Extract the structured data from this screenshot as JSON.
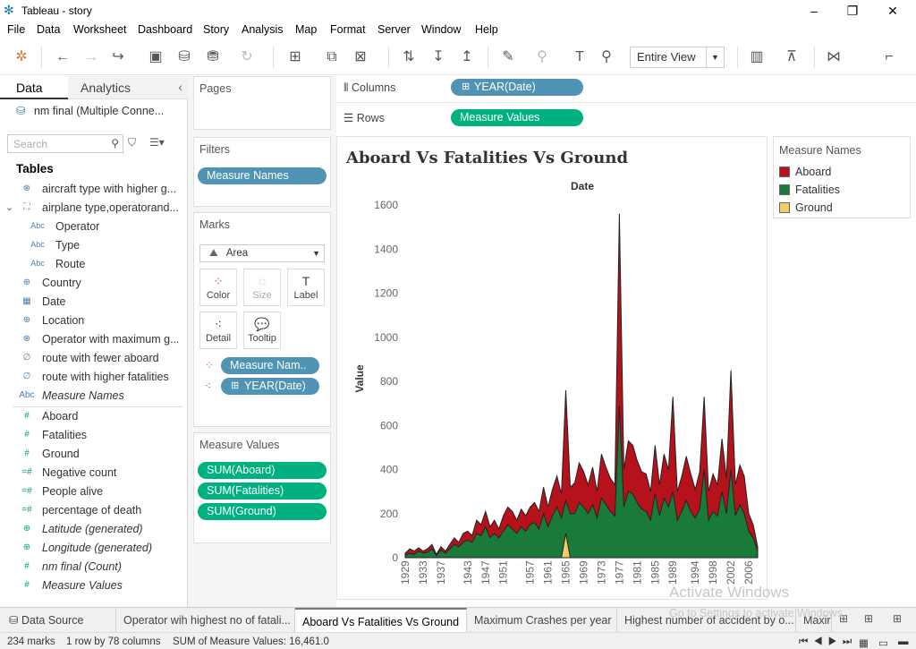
{
  "window": {
    "title": "Tableau - story",
    "min": "–",
    "max": "❐",
    "close": "✕"
  },
  "menu": [
    "File",
    "Data",
    "Worksheet",
    "Dashboard",
    "Story",
    "Analysis",
    "Map",
    "Format",
    "Server",
    "Window",
    "Help"
  ],
  "toolbar": {
    "fit_label": "Entire View"
  },
  "left": {
    "tab_data": "Data",
    "tab_analytics": "Analytics",
    "datasource": "nm final (Multiple Conne...",
    "search_placeholder": "Search",
    "tables_heading": "Tables",
    "fields": [
      {
        "label": "aircraft type with higher g...",
        "icon": "set-icon",
        "glyph": "⊗",
        "type": "dim"
      },
      {
        "label": "airplane type,operatorand...",
        "icon": "hierarchy-icon",
        "glyph": "⛶",
        "type": "dim"
      },
      {
        "label": "Operator",
        "icon": "abc-icon",
        "glyph": "Abc",
        "type": "sub"
      },
      {
        "label": "Type",
        "icon": "abc-icon",
        "glyph": "Abc",
        "type": "sub"
      },
      {
        "label": "Route",
        "icon": "abc-icon",
        "glyph": "Abc",
        "type": "sub"
      },
      {
        "label": "Country",
        "icon": "globe-icon",
        "glyph": "⊕",
        "type": "dim"
      },
      {
        "label": "Date",
        "icon": "calendar-icon",
        "glyph": "▦",
        "type": "dim"
      },
      {
        "label": "Location",
        "icon": "globe-icon",
        "glyph": "⊕",
        "type": "dim"
      },
      {
        "label": "Operator with maximum g...",
        "icon": "set-icon",
        "glyph": "⊗",
        "type": "dim"
      },
      {
        "label": "route with fewer aboard",
        "icon": "set-icon",
        "glyph": "∅",
        "type": "dim"
      },
      {
        "label": "route with higher fatalities",
        "icon": "set-icon",
        "glyph": "∅",
        "type": "dim"
      },
      {
        "label": "Measure Names",
        "icon": "abc-icon",
        "glyph": "Abc",
        "type": "ital"
      },
      {
        "label": "Aboard",
        "icon": "hash-icon",
        "glyph": "#",
        "type": "measure"
      },
      {
        "label": "Fatalities",
        "icon": "hash-icon",
        "glyph": "#",
        "type": "measure"
      },
      {
        "label": "Ground",
        "icon": "hash-icon",
        "glyph": "#",
        "type": "measure"
      },
      {
        "label": "Negative count",
        "icon": "calc-hash-icon",
        "glyph": "=#",
        "type": "measure"
      },
      {
        "label": "People alive",
        "icon": "calc-hash-icon",
        "glyph": "=#",
        "type": "measure"
      },
      {
        "label": "percentage of death",
        "icon": "calc-hash-icon",
        "glyph": "=#",
        "type": "measure"
      },
      {
        "label": "Latitude (generated)",
        "icon": "globe-icon",
        "glyph": "⊕",
        "type": "measure-ital"
      },
      {
        "label": "Longitude (generated)",
        "icon": "globe-icon",
        "glyph": "⊕",
        "type": "measure-ital"
      },
      {
        "label": "nm final (Count)",
        "icon": "hash-icon",
        "glyph": "#",
        "type": "measure-ital"
      },
      {
        "label": "Measure Values",
        "icon": "hash-icon",
        "glyph": "#",
        "type": "measure-ital"
      }
    ]
  },
  "shelves": {
    "pages": "Pages",
    "filters": "Filters",
    "filter_pill": "Measure Names",
    "marks": "Marks",
    "mark_type": "Area",
    "mark_buttons": {
      "color": "Color",
      "size": "Size",
      "label": "Label",
      "detail": "Detail",
      "tooltip": "Tooltip"
    },
    "mark_pill_color": "Measure Nam..",
    "mark_pill_detail": "YEAR(Date)",
    "measure_values_heading": "Measure Values",
    "measure_values": [
      "SUM(Aboard)",
      "SUM(Fatalities)",
      "SUM(Ground)"
    ],
    "columns_label": "Columns",
    "columns_pill": "YEAR(Date)",
    "rows_label": "Rows",
    "rows_pill": "Measure Values"
  },
  "legend": {
    "title": "Measure Names",
    "items": [
      {
        "name": "Aboard",
        "color": "#b5121b"
      },
      {
        "name": "Fatalities",
        "color": "#1a7a3a"
      },
      {
        "name": "Ground",
        "color": "#f1ce63"
      }
    ]
  },
  "chart_data": {
    "type": "area",
    "title": "Aboard Vs Fatalities Vs Ground",
    "xlabel": "Date",
    "ylabel": "Value",
    "ylim": [
      0,
      1600
    ],
    "yticks": [
      0,
      200,
      400,
      600,
      800,
      1000,
      1200,
      1400,
      1600
    ],
    "xticks": [
      "1929",
      "1933",
      "1937",
      "1943",
      "1947",
      "1951",
      "1957",
      "1961",
      "1965",
      "1969",
      "1973",
      "1977",
      "1981",
      "1985",
      "1989",
      "1994",
      "1998",
      "2002",
      "2006"
    ],
    "x": [
      1929,
      1930,
      1931,
      1932,
      1933,
      1934,
      1935,
      1936,
      1937,
      1938,
      1939,
      1940,
      1941,
      1942,
      1943,
      1944,
      1945,
      1946,
      1947,
      1948,
      1949,
      1950,
      1951,
      1952,
      1953,
      1954,
      1955,
      1956,
      1957,
      1958,
      1959,
      1960,
      1961,
      1962,
      1963,
      1964,
      1965,
      1966,
      1967,
      1968,
      1969,
      1970,
      1971,
      1972,
      1973,
      1974,
      1975,
      1976,
      1977,
      1978,
      1979,
      1980,
      1981,
      1982,
      1983,
      1984,
      1985,
      1986,
      1987,
      1988,
      1989,
      1990,
      1991,
      1992,
      1993,
      1994,
      1995,
      1996,
      1997,
      1998,
      1999,
      2000,
      2001,
      2002,
      2003,
      2004,
      2005,
      2006,
      2007,
      2008
    ],
    "series": [
      {
        "name": "Aboard",
        "values": [
          20,
          40,
          30,
          45,
          30,
          40,
          60,
          15,
          50,
          30,
          60,
          90,
          70,
          110,
          120,
          100,
          170,
          150,
          210,
          140,
          170,
          130,
          190,
          230,
          210,
          170,
          220,
          190,
          230,
          250,
          210,
          320,
          230,
          310,
          370,
          290,
          760,
          320,
          340,
          430,
          390,
          330,
          410,
          300,
          470,
          410,
          360,
          330,
          1560,
          400,
          530,
          510,
          440,
          390,
          380,
          300,
          510,
          330,
          470,
          400,
          730,
          300,
          370,
          460,
          380,
          310,
          390,
          730,
          300,
          380,
          330,
          540,
          360,
          850,
          330,
          420,
          370,
          200,
          150,
          50
        ]
      },
      {
        "name": "Fatalities",
        "values": [
          10,
          20,
          15,
          30,
          20,
          25,
          40,
          10,
          35,
          20,
          40,
          60,
          50,
          70,
          80,
          70,
          110,
          100,
          140,
          90,
          110,
          90,
          120,
          150,
          130,
          110,
          140,
          120,
          150,
          160,
          130,
          200,
          140,
          190,
          230,
          180,
          260,
          200,
          200,
          250,
          230,
          200,
          240,
          180,
          270,
          240,
          210,
          190,
          690,
          230,
          300,
          290,
          250,
          220,
          210,
          170,
          290,
          190,
          270,
          230,
          300,
          170,
          210,
          260,
          210,
          180,
          220,
          400,
          170,
          210,
          190,
          300,
          200,
          400,
          190,
          240,
          200,
          120,
          90,
          30
        ]
      },
      {
        "name": "Ground",
        "values": [
          0,
          0,
          0,
          0,
          0,
          0,
          0,
          0,
          0,
          0,
          0,
          0,
          0,
          0,
          0,
          0,
          0,
          0,
          0,
          0,
          0,
          0,
          0,
          0,
          0,
          0,
          0,
          0,
          0,
          0,
          0,
          0,
          0,
          0,
          0,
          0,
          110,
          0,
          0,
          0,
          0,
          0,
          0,
          0,
          0,
          0,
          0,
          0,
          0,
          0,
          0,
          0,
          0,
          0,
          0,
          0,
          0,
          0,
          0,
          0,
          0,
          0,
          0,
          0,
          0,
          0,
          0,
          0,
          0,
          0,
          0,
          0,
          0,
          0,
          0,
          0,
          0,
          0,
          0,
          0
        ]
      }
    ],
    "grid": false,
    "legend_position": "right"
  },
  "bottom_tabs": {
    "data_source": "Data Source",
    "sheets": [
      "Operator wih highest no of fatali...",
      "Aboard Vs Fatalities Vs Ground",
      "Maximum Crashes per year",
      "Highest number of accident by o...",
      "Maxir"
    ]
  },
  "status": {
    "marks": "234 marks",
    "layout": "1 row by 78 columns",
    "sum": "SUM of Measure Values: 16,461.0"
  },
  "watermark": {
    "line1": "Activate Windows",
    "line2": "Go to Settings to activate Windows."
  }
}
